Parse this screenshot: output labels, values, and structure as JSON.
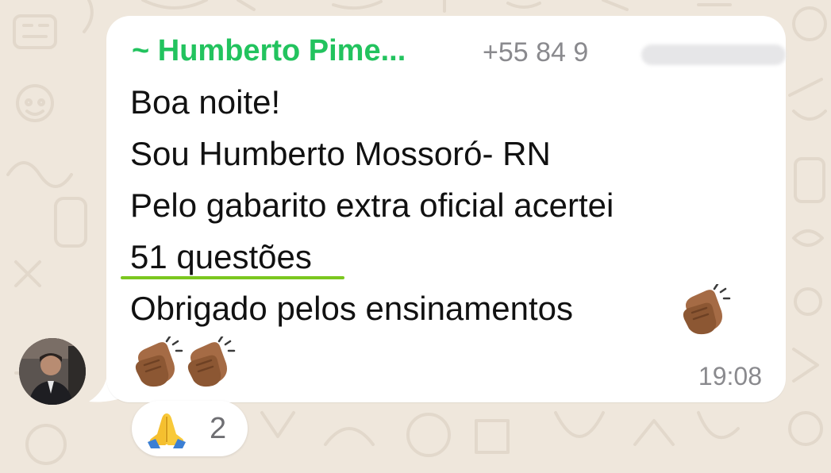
{
  "chat": {
    "background_color": "#efe7dc",
    "bubble_color": "#ffffff"
  },
  "message": {
    "sender_name": "~ Humberto Pime...",
    "sender_color": "#22c35e",
    "sender_phone": "+55 84 9",
    "lines": [
      "Boa noite!",
      "Sou Humberto Mossoró- RN",
      "Pelo gabarito extra oficial acertei",
      "51 questões",
      "Obrigado pelos ensinamentos"
    ],
    "emojis": [
      "clapping-hands-icon",
      "clapping-hands-icon",
      "clapping-hands-icon"
    ],
    "time": "19:08",
    "highlight_color": "#7bc71f"
  },
  "reaction": {
    "emoji": "folded-hands-icon",
    "count": "2"
  },
  "avatar": {
    "icon": "avatar"
  }
}
